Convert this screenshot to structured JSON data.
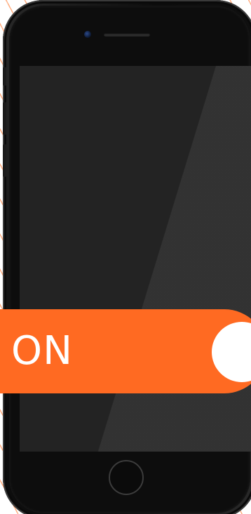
{
  "toggle": {
    "label": "ON",
    "state": "on",
    "color": "#ff6a22",
    "knob_color": "#ffffff"
  },
  "device": {
    "type": "phone",
    "body_color": "#0d0d0d",
    "screen_color": "#232323",
    "icons": [
      "front-camera-icon",
      "speaker-grille-icon",
      "home-button-icon"
    ]
  },
  "background": {
    "pattern": "diagonal-stripes",
    "stripe_color": "#ff6b1a"
  }
}
